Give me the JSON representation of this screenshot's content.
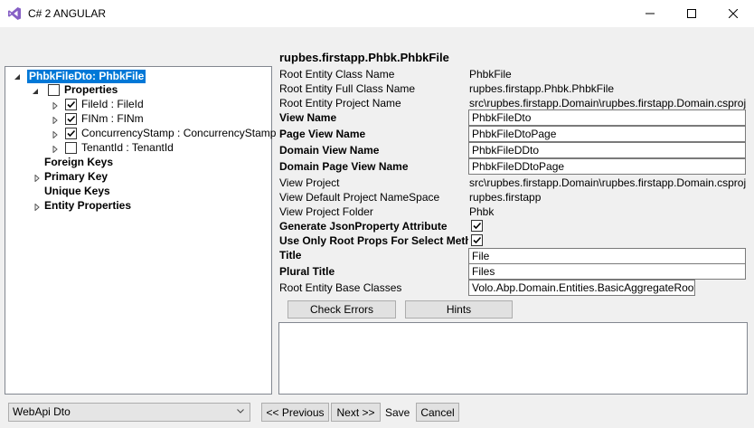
{
  "window": {
    "title": "C# 2 ANGULAR"
  },
  "heading": "rupbes.firstapp.Phbk.PhbkFile",
  "tree": {
    "root": "PhbkFileDto: PhbkFile",
    "properties": "Properties",
    "fields": [
      {
        "label": "FileId : FileId",
        "checked": true
      },
      {
        "label": "FINm : FINm",
        "checked": true
      },
      {
        "label": "ConcurrencyStamp : ConcurrencyStamp",
        "checked": true
      },
      {
        "label": "TenantId : TenantId",
        "checked": false
      }
    ],
    "foreign_keys": "Foreign Keys",
    "primary_key": "Primary Key",
    "unique_keys": "Unique Keys",
    "entity_properties": "Entity Properties"
  },
  "form": {
    "root_class_label": "Root Entity Class Name",
    "root_class_value": "PhbkFile",
    "root_full_label": "Root Entity Full Class Name",
    "root_full_value": "rupbes.firstapp.Phbk.PhbkFile",
    "root_project_label": "Root Entity Project Name",
    "root_project_value": "src\\rupbes.firstapp.Domain\\rupbes.firstapp.Domain.csproj",
    "view_name_label": "View Name",
    "view_name_value": "PhbkFileDto",
    "page_view_label": "Page View Name",
    "page_view_value": "PhbkFileDtoPage",
    "domain_view_label": "Domain View Name",
    "domain_view_value": "PhbkFileDDto",
    "domain_page_label": "Domain Page View Name",
    "domain_page_value": "PhbkFileDDtoPage",
    "view_project_label": "View Project",
    "view_project_value": "src\\rupbes.firstapp.Domain\\rupbes.firstapp.Domain.csproj",
    "view_ns_label": "View Default Project NameSpace",
    "view_ns_value": "rupbes.firstapp",
    "view_folder_label": "View Project Folder",
    "view_folder_value": "Phbk",
    "json_attr_label": "Generate JsonProperty Attribute",
    "json_attr_checked": true,
    "root_props_label": "Use Only Root Props For Select Metho",
    "root_props_checked": true,
    "title_label": "Title",
    "title_value": "File",
    "plural_label": "Plural Title",
    "plural_value": "Files",
    "base_classes_label": "Root Entity Base Classes",
    "base_classes_value": "Volo.Abp.Domain.Entities.BasicAggregateRoot"
  },
  "buttons": {
    "check_errors": "Check Errors",
    "hints": "Hints",
    "previous": "<< Previous",
    "next": "Next >>",
    "save": "Save",
    "cancel": "Cancel"
  },
  "combo": {
    "selected": "WebApi Dto"
  }
}
